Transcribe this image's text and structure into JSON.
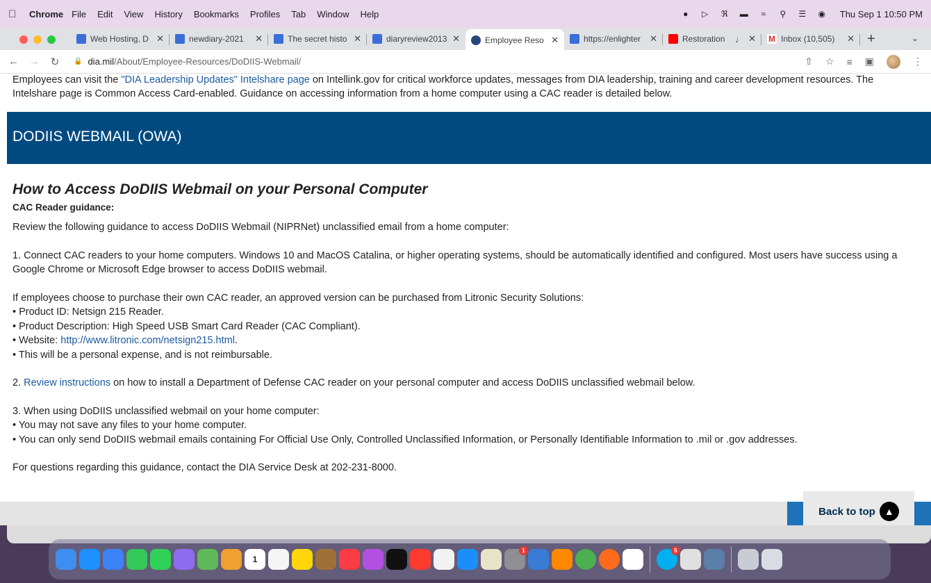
{
  "menubar": {
    "app_name": "Chrome",
    "items": [
      "File",
      "Edit",
      "View",
      "History",
      "Bookmarks",
      "Profiles",
      "Tab",
      "Window",
      "Help"
    ],
    "clock": "Thu Sep 1  10:50 PM"
  },
  "tabs": [
    {
      "title": "Web Hosting, D",
      "color": "#3a6fd8"
    },
    {
      "title": "newdiary-2021",
      "color": "#3a6fd8"
    },
    {
      "title": "The secret histo",
      "color": "#3a6fd8"
    },
    {
      "title": "diaryreview2013",
      "color": "#3a6fd8"
    },
    {
      "title": "Employee Reso",
      "color": "#24487a"
    },
    {
      "title": "https://enlighter",
      "color": "#3a6fd8"
    },
    {
      "title": "Restoration",
      "color": "#ff0000"
    },
    {
      "title": "Inbox (10,505)",
      "color": "#d93025"
    }
  ],
  "address": {
    "host": "dia.mil",
    "path": "/About/Employee-Resources/DoDIIS-Webmail/"
  },
  "intro": {
    "before": "Employees can visit the ",
    "link": "\"DIA Leadership Updates\" Intelshare page",
    "after": " on Intellink.gov for critical workforce updates, messages from DIA leadership, training and career development resources. The Intelshare page is Common Access Card-enabled. Guidance on accessing information from a home computer using a CAC reader is detailed below."
  },
  "banner_title": "DODIIS WEBMAIL (OWA)",
  "content": {
    "heading": "How to Access DoDIIS Webmail on your Personal Computer",
    "subheading": "CAC Reader guidance:",
    "p1": "Review the following guidance to access DoDIIS Webmail (NIPRNet) unclassified email from a home computer:",
    "p2": "1. Connect CAC readers to your home computers. Windows 10 and MacOS Catalina, or higher operating systems, should be automatically identified and configured. Most users have success using a Google Chrome or Microsoft Edge browser to access DoDIIS webmail.",
    "purchase_intro": "If employees choose to purchase their own CAC reader, an approved version can be purchased from Litronic Security Solutions:",
    "product_id": "• Product ID: Netsign 215 Reader.",
    "product_desc": "• Product Description: High Speed USB Smart Card Reader (CAC Compliant).",
    "website_label": "• Website: ",
    "website_link": "http://www.litronic.com/netsign215.html",
    "website_end": ".",
    "expense": "• This will be a personal expense, and is not reimbursable.",
    "step2_prefix": "2. ",
    "step2_link": "Review instructions",
    "step2_rest": " on how to install a Department of Defense CAC reader on your personal computer and access DoDIIS unclassified webmail below.",
    "step3": "3. When using DoDIIS unclassified webmail on your home computer:",
    "rule1": "• You may not save any files to your home computer.",
    "rule2": "• You can only send DoDIIS webmail emails containing For Official Use Only, Controlled Unclassified Information, or Personally Identifiable Information to .mil or .gov addresses.",
    "questions": "For questions regarding this guidance, contact the DIA Service Desk at 202-231-8000."
  },
  "back_to_top": "Back to top",
  "dock": {
    "calendar_day": "1",
    "badges": {
      "system_prefs": "1",
      "skype": "5"
    }
  }
}
